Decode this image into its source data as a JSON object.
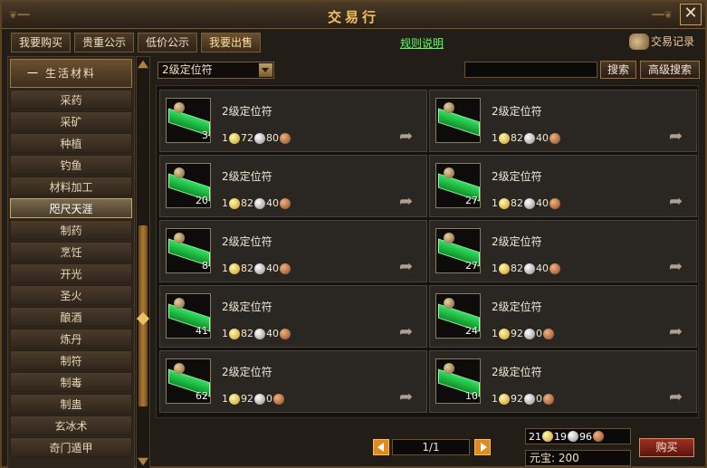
{
  "window": {
    "title": "交易行",
    "close_label": "✕"
  },
  "tabs": [
    {
      "label": "我要购买"
    },
    {
      "label": "贵重公示"
    },
    {
      "label": "低价公示"
    },
    {
      "label": "我要出售"
    }
  ],
  "rules_link": "规则说明",
  "history_button": "交易记录",
  "sidebar": {
    "category": {
      "label": "生活材料",
      "toggle": "一"
    },
    "items": [
      {
        "label": "采药"
      },
      {
        "label": "采矿"
      },
      {
        "label": "种植"
      },
      {
        "label": "钓鱼"
      },
      {
        "label": "材料加工"
      },
      {
        "label": "咫尺天涯",
        "selected": true
      },
      {
        "label": "制药"
      },
      {
        "label": "烹饪"
      },
      {
        "label": "开光"
      },
      {
        "label": "圣火"
      },
      {
        "label": "酿酒"
      },
      {
        "label": "炼丹"
      },
      {
        "label": "制符"
      },
      {
        "label": "制毒"
      },
      {
        "label": "制蛊"
      },
      {
        "label": "玄冰术"
      },
      {
        "label": "奇门遁甲"
      }
    ]
  },
  "filter": {
    "dropdown_value": "2级定位符",
    "search_value": "",
    "search_button": "搜索",
    "advanced_button": "高级搜索"
  },
  "listings": [
    {
      "name": "2级定位符",
      "qty": "3",
      "gold": "1",
      "silver": "72",
      "copper": "80"
    },
    {
      "name": "2级定位符",
      "qty": "",
      "gold": "1",
      "silver": "82",
      "copper": "40"
    },
    {
      "name": "2级定位符",
      "qty": "20",
      "gold": "1",
      "silver": "82",
      "copper": "40"
    },
    {
      "name": "2级定位符",
      "qty": "27",
      "gold": "1",
      "silver": "82",
      "copper": "40"
    },
    {
      "name": "2级定位符",
      "qty": "8",
      "gold": "1",
      "silver": "82",
      "copper": "40"
    },
    {
      "name": "2级定位符",
      "qty": "27",
      "gold": "1",
      "silver": "82",
      "copper": "40"
    },
    {
      "name": "2级定位符",
      "qty": "41",
      "gold": "1",
      "silver": "82",
      "copper": "40"
    },
    {
      "name": "2级定位符",
      "qty": "24",
      "gold": "1",
      "silver": "92",
      "copper": "0"
    },
    {
      "name": "2级定位符",
      "qty": "62",
      "gold": "1",
      "silver": "92",
      "copper": "0"
    },
    {
      "name": "2级定位符",
      "qty": "10",
      "gold": "1",
      "silver": "92",
      "copper": "0"
    }
  ],
  "pager": {
    "text": "1/1"
  },
  "wallet": {
    "gold": "21",
    "silver": "19",
    "copper": "96"
  },
  "yuanbao": "元宝:  200",
  "buy_button": "购买",
  "colors": {
    "title": "#f0c060",
    "link": "#60ff60",
    "buy": "#a03020",
    "pager": "#e08a20"
  },
  "icons": [
    "close-icon",
    "scroll-history-icon",
    "dropdown-arrow-icon",
    "share-arrow-icon",
    "gold-coin-icon",
    "silver-coin-icon",
    "copper-coin-icon",
    "prev-page-icon",
    "next-page-icon"
  ]
}
